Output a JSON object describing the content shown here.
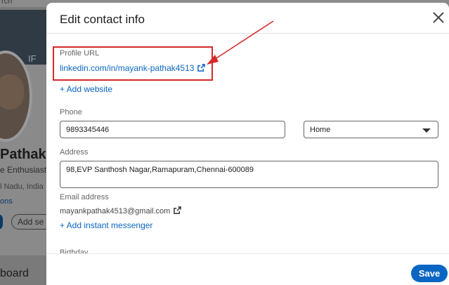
{
  "background": {
    "topbar_text": "rch",
    "banner_text": "IF",
    "name": "Pathak",
    "headline": "e Enthusiast",
    "location": "l Nadu, India",
    "connections": "ons",
    "add_section_label": "Add se",
    "dashboard_label": "board"
  },
  "modal": {
    "title": "Edit contact info",
    "profile_url_label": "Profile URL",
    "profile_url": "linkedin.com/in/mayank-pathak4513",
    "add_website": "+ Add website",
    "phone_label": "Phone",
    "phone_value": "9893345446",
    "phone_type": "Home",
    "address_label": "Address",
    "address_value": "98,EVP Santhosh Nagar,Ramapuram,Chennai-600089",
    "email_label": "Email address",
    "email_value": "mayankpathak4513@gmail.com",
    "add_im": "+ Add instant messenger",
    "birthday_label": "Birthday",
    "save_label": "Save"
  },
  "colors": {
    "accent": "#0a66c2",
    "annotation": "#d42a2a"
  },
  "icons": {
    "close": "close-icon",
    "external_link": "external-link-icon",
    "dropdown": "chevron-down-icon"
  }
}
